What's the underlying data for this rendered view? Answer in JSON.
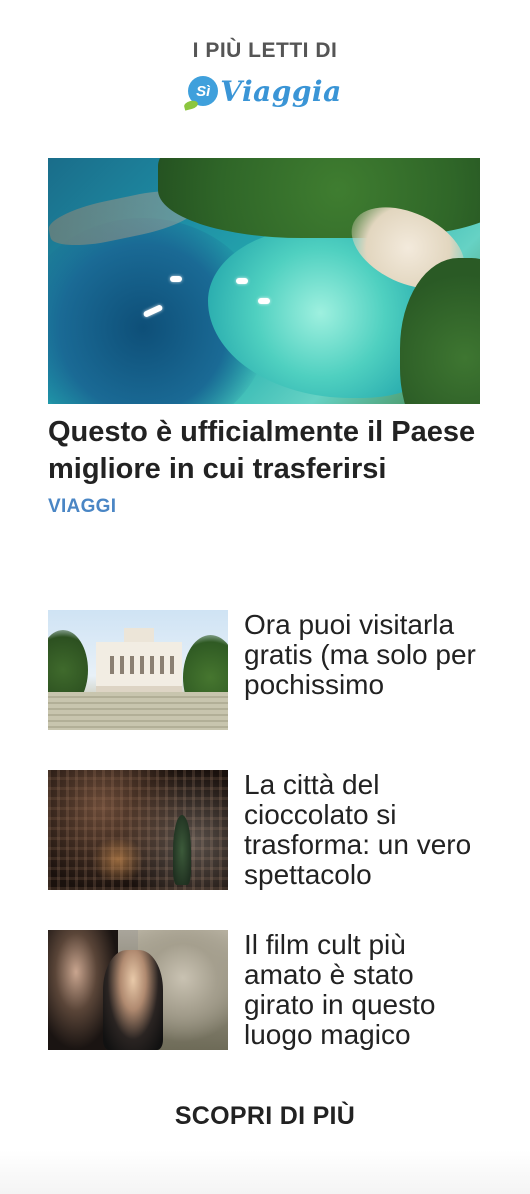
{
  "header": {
    "kicker": "I PIÙ LETTI DI",
    "logo_badge": "Sì",
    "logo_word": "Viaggia"
  },
  "hero": {
    "title": "Questo è ufficialmente il Paese migliore in cui trasferirsi",
    "category": "VIAGGI",
    "image_subject": "aerial-bay-photo"
  },
  "list": [
    {
      "title": "Ora puoi visitarla gratis (ma solo per pochissimo",
      "image_subject": "villa-photo"
    },
    {
      "title": "La città del cioccolato si trasforma: un vero spettacolo",
      "image_subject": "night-town-photo"
    },
    {
      "title": "Il film cult più amato è stato girato in questo luogo magico",
      "image_subject": "film-scene-photo"
    }
  ],
  "more": {
    "label": "SCOPRI DI PIÙ"
  },
  "colors": {
    "accent": "#4a86c5",
    "logo_blue": "#3a95d6",
    "logo_green": "#8cc63f",
    "text": "#222222",
    "kicker": "#555555"
  }
}
